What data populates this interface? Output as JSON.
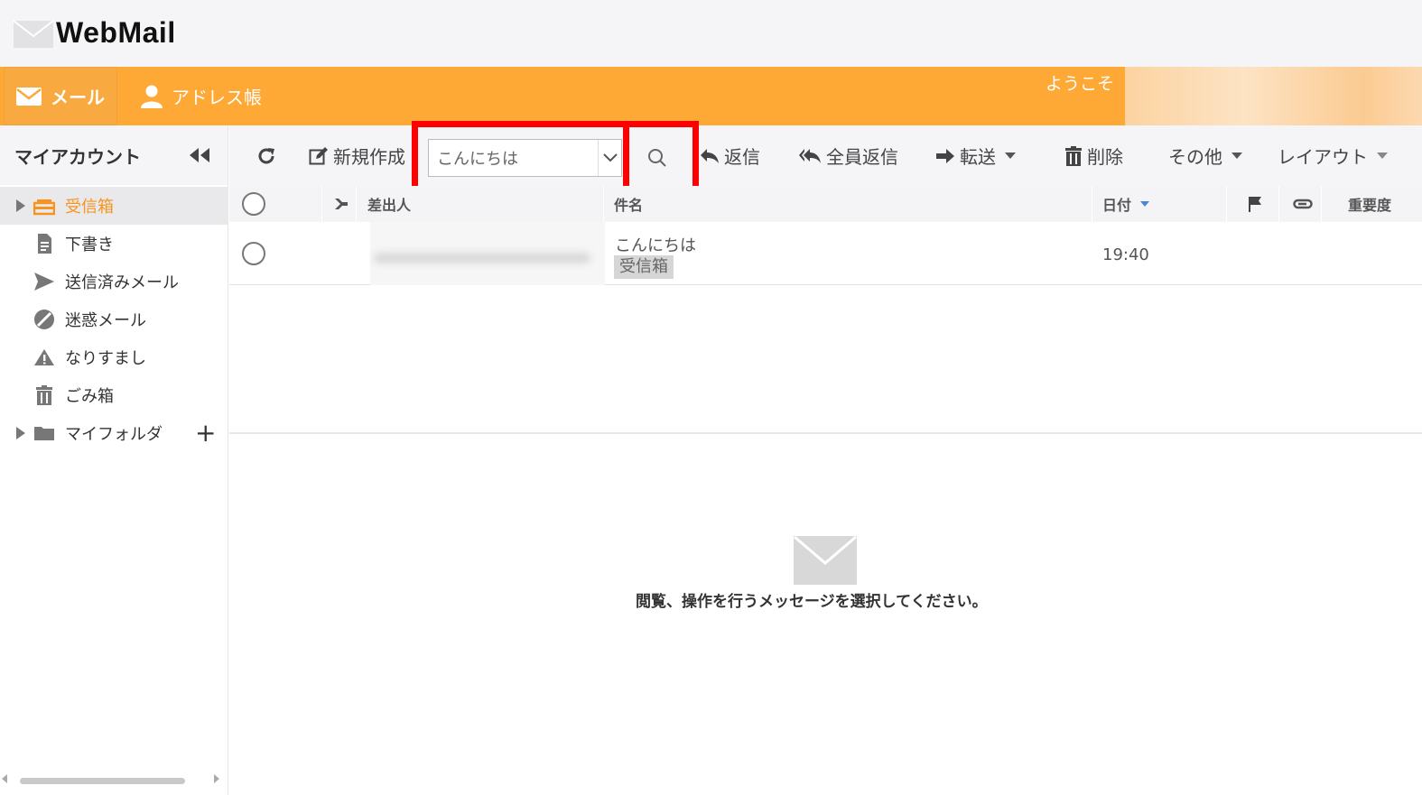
{
  "app": {
    "logo_text": "WebMail"
  },
  "nav": {
    "tabs": [
      {
        "label": "メール",
        "icon": "envelope-icon"
      },
      {
        "label": "アドレス帳",
        "icon": "user-icon"
      }
    ],
    "welcome": "ようこそ"
  },
  "sidebar": {
    "title": "マイアカウント",
    "folders": [
      {
        "label": "受信箱",
        "icon": "inbox-icon"
      },
      {
        "label": "下書き",
        "icon": "draft-icon"
      },
      {
        "label": "送信済みメール",
        "icon": "send-icon"
      },
      {
        "label": "迷惑メール",
        "icon": "block-icon"
      },
      {
        "label": "なりすまし",
        "icon": "warning-icon"
      },
      {
        "label": "ごみ箱",
        "icon": "trash-icon"
      },
      {
        "label": "マイフォルダ",
        "icon": "folder-icon"
      }
    ],
    "add_label": "+"
  },
  "toolbar": {
    "new_label": "新規作成",
    "search_value": "こんにちは",
    "reply_label": "返信",
    "reply_all_label": "全員返信",
    "forward_label": "転送",
    "delete_label": "削除",
    "more_label": "その他",
    "layout_label": "レイアウト"
  },
  "columns": {
    "sender": "差出人",
    "subject": "件名",
    "date": "日付",
    "importance": "重要度"
  },
  "messages": [
    {
      "subject": "こんにちは",
      "folder_tag": "受信箱",
      "date": "19:40"
    }
  ],
  "preview": {
    "empty_message": "閲覧、操作を行うメッセージを選択してください。"
  },
  "colors": {
    "accent": "#fea836",
    "folder_active": "#f7931e",
    "highlight": "#ff0000"
  }
}
